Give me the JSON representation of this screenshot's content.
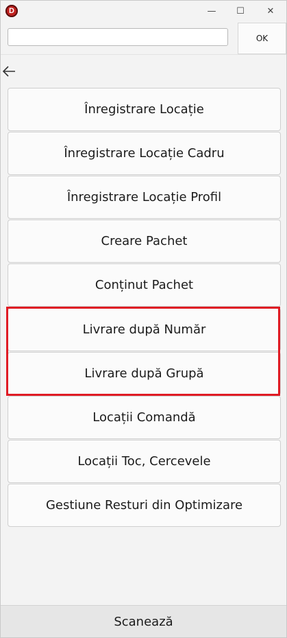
{
  "titlebar": {
    "app_icon_letter": "D",
    "minimize_glyph": "—",
    "maximize_glyph": "☐",
    "close_glyph": "✕"
  },
  "search": {
    "value": "",
    "placeholder": "",
    "ok_label": "OK"
  },
  "menu": {
    "items": [
      {
        "label": "Înregistrare Locație"
      },
      {
        "label": "Înregistrare Locație Cadru"
      },
      {
        "label": "Înregistrare Locație Profil"
      },
      {
        "label": "Creare Pachet"
      },
      {
        "label": "Conținut Pachet"
      },
      {
        "label": "Livrare după Număr"
      },
      {
        "label": "Livrare după Grupă"
      },
      {
        "label": "Locații Comandă"
      },
      {
        "label": "Locații Toc, Cercevele"
      },
      {
        "label": "Gestiune Resturi din Optimizare"
      }
    ]
  },
  "footer": {
    "scan_label": "Scanează"
  },
  "colors": {
    "highlight": "#e01b24",
    "app_icon": "#c0211f"
  },
  "icons": {
    "back": "back-arrow-icon",
    "app": "app-logo-icon"
  }
}
